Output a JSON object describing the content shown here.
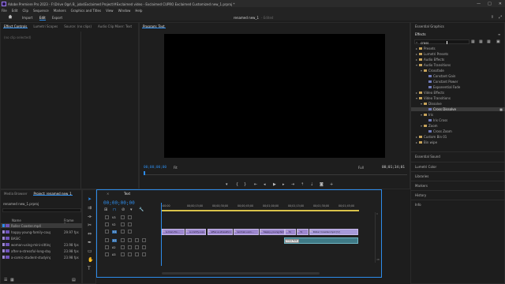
{
  "window": {
    "title": "Adobe Premiere Pro 2023 - F:\\Drive Ogs\\ B_ jobs\\Exclaimed Project\\#Exclaimed video - Exclaimed CUPRO Exclaimed Customized new_1.prproj *",
    "min": "—",
    "max": "□",
    "close": "✕"
  },
  "menu": [
    "File",
    "Edit",
    "Clip",
    "Sequence",
    "Markers",
    "Graphics and Titles",
    "View",
    "Window",
    "Help"
  ],
  "workspace": {
    "tabs": [
      "Import",
      "Edit",
      "Export"
    ],
    "active": "Edit",
    "center_title": "renamed new_1",
    "center_suffix": "- Edited"
  },
  "source_panel": {
    "tabs": [
      "Effect Controls",
      "Lumetri Scopes",
      "Source: (no clips)",
      "Audio Clip Mixer: Text"
    ],
    "empty_text": "(no clip selected)"
  },
  "program": {
    "tab": "Program: Text",
    "timecode_left": "00;00;00;00",
    "fit": "Fit",
    "quality": "Full",
    "timecode_right": "00;01;34;01"
  },
  "project": {
    "tabs": [
      "Media Browser",
      "Project: renamed new_1"
    ],
    "path": "renamed new_1.prproj",
    "col_name": "Name",
    "col_rate": "Frame Rate",
    "items": [
      {
        "name": "Roller Coaster.mp4",
        "rate": "",
        "color": "#2d8ceb",
        "selected": true
      },
      {
        "name": "happy-young-family-couple...",
        "rate": "29.97 fps",
        "color": "#9b86d0"
      },
      {
        "name": "BASIC",
        "rate": "",
        "color": "#9b86d0"
      },
      {
        "name": "woman-using-mini-sitting...",
        "rate": "23.98 fps",
        "color": "#9b86d0"
      },
      {
        "name": "after-a-stressful-long-day-in...",
        "rate": "23.98 fps",
        "color": "#9b86d0"
      },
      {
        "name": "a-comic-student-studying-in...",
        "rate": "23.98 fps",
        "color": "#9b86d0"
      }
    ]
  },
  "timeline": {
    "tab": "Text",
    "timecode": "00;00;00;00",
    "ruler": [
      ":00:00",
      "00;00;15;00",
      "00;00;30;00",
      "00;00;45;00",
      "00;01;00;00",
      "00;01;15;00",
      "00;01;30;00",
      "00;01;45;00"
    ],
    "tracks": [
      "V3",
      "V2",
      "V1",
      "A1",
      "A2",
      "A3"
    ],
    "clips": [
      {
        "label": "a-man-fro...",
        "track": "V1",
        "start": 0,
        "end": 0.116
      },
      {
        "label": "a-comfy-sup...",
        "track": "V1",
        "start": 0.12,
        "end": 0.225
      },
      {
        "label": "after-a-stressful-l...",
        "track": "V1",
        "start": 0.23,
        "end": 0.36
      },
      {
        "label": "woman-usin...",
        "track": "V1",
        "start": 0.362,
        "end": 0.49
      },
      {
        "label": "happy-young-family...",
        "track": "V1",
        "start": 0.495,
        "end": 0.623
      },
      {
        "label": "fx",
        "track": "V1",
        "start": 0.625,
        "end": 0.68
      },
      {
        "label": "fx",
        "track": "V1",
        "start": 0.682,
        "end": 0.745
      },
      {
        "label": "Roller Coaster.mp4 [V]",
        "track": "V1",
        "start": 0.747,
        "end": 0.995
      }
    ],
    "audio_clip_label": "Cross Fade"
  },
  "effects": {
    "workspace_label": "Essential Graphics",
    "tab": "Effects",
    "search_value": "cross",
    "tree": [
      {
        "label": "Presets",
        "depth": 0,
        "kind": "folder",
        "expanded": false
      },
      {
        "label": "Lumetri Presets",
        "depth": 0,
        "kind": "folder",
        "expanded": false
      },
      {
        "label": "Audio Effects",
        "depth": 0,
        "kind": "folder",
        "expanded": false
      },
      {
        "label": "Audio Transitions",
        "depth": 0,
        "kind": "folder",
        "expanded": true
      },
      {
        "label": "Crossfade",
        "depth": 1,
        "kind": "folder",
        "expanded": true
      },
      {
        "label": "Constant Gain",
        "depth": 2,
        "kind": "fx"
      },
      {
        "label": "Constant Power",
        "depth": 2,
        "kind": "fx"
      },
      {
        "label": "Exponential Fade",
        "depth": 2,
        "kind": "fx"
      },
      {
        "label": "Video Effects",
        "depth": 0,
        "kind": "folder",
        "expanded": false
      },
      {
        "label": "Video Transitions",
        "depth": 0,
        "kind": "folder",
        "expanded": true
      },
      {
        "label": "Dissolve",
        "depth": 1,
        "kind": "folder",
        "expanded": true
      },
      {
        "label": "Cross Dissolve",
        "depth": 2,
        "kind": "fx",
        "selected": true
      },
      {
        "label": "Iris",
        "depth": 1,
        "kind": "folder",
        "expanded": true
      },
      {
        "label": "Iris Cross",
        "depth": 2,
        "kind": "fx"
      },
      {
        "label": "Zoom",
        "depth": 1,
        "kind": "folder",
        "expanded": true
      },
      {
        "label": "Cross Zoom",
        "depth": 2,
        "kind": "fx"
      },
      {
        "label": "Custom Bin 01",
        "depth": 0,
        "kind": "folder",
        "expanded": false
      },
      {
        "label": "Bin wipe",
        "depth": 0,
        "kind": "folder",
        "expanded": false
      }
    ],
    "sections": [
      "Essential Sound",
      "Lumetri Color",
      "Libraries",
      "Markers",
      "History",
      "Info"
    ]
  },
  "colors": {
    "accent": "#2d8ceb",
    "clip": "#9d87cf",
    "audio": "#3f7a86",
    "playhead": "#2d8ceb",
    "work_area": "#d8c24a"
  }
}
